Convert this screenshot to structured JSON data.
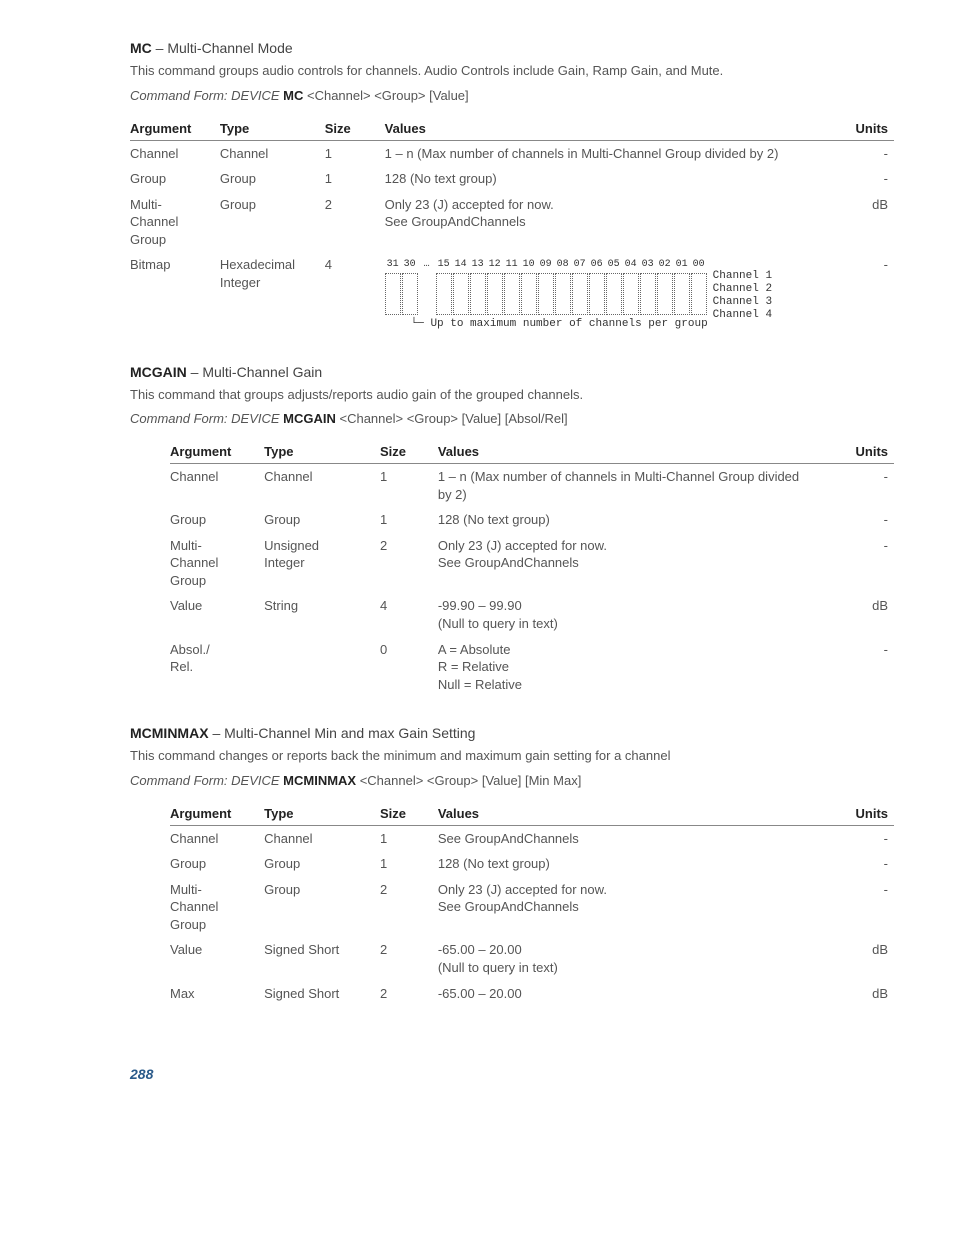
{
  "page_number": "288",
  "sections": [
    {
      "id": "mc",
      "code": "MC",
      "title": "Multi-Channel Mode",
      "desc": "This command groups audio controls for channels.  Audio Controls include Gain, Ramp Gain, and Mute.",
      "cmd_prefix": "Command Form:  DEVICE ",
      "cmd_code": "MC",
      "cmd_suffix": " <Channel> <Group> [Value]",
      "indent": false,
      "cols": {
        "arg": "Argument",
        "type": "Type",
        "size": "Size",
        "values": "Values",
        "units": "Units"
      },
      "rows": [
        {
          "arg": "Channel",
          "type": "Channel",
          "size": "1",
          "values": "1 – n (Max number of channels in Multi-Channel Group divided by 2)",
          "units": "-"
        },
        {
          "arg": "Group",
          "type": "Group",
          "size": "1",
          "values": "128 (No text group)",
          "units": "-"
        },
        {
          "arg": "Multi-\nChannel\nGroup",
          "type": "Group",
          "size": "2",
          "values": "Only 23 (J) accepted for now.\nSee GroupAndChannels",
          "units": "dB"
        },
        {
          "arg": "Bitmap",
          "type": "Hexadecimal\nInteger",
          "size": "4",
          "values_is_bitmap": true,
          "units": "-"
        }
      ],
      "bitmap": {
        "bits_left": [
          "31",
          "30"
        ],
        "bits_ellipsis": "…",
        "bits_right": [
          "15",
          "14",
          "13",
          "12",
          "11",
          "10",
          "09",
          "08",
          "07",
          "06",
          "05",
          "04",
          "03",
          "02",
          "01",
          "00"
        ],
        "labels": [
          "Channel 1",
          "Channel 2",
          "Channel 3",
          "Channel 4"
        ],
        "caption": "Up to maximum number of channels per group"
      }
    },
    {
      "id": "mcgain",
      "code": "MCGAIN",
      "title": "Multi-Channel Gain",
      "desc": "This command that groups adjusts/reports audio gain of the grouped channels.",
      "cmd_prefix": "Command Form:  DEVICE ",
      "cmd_code": "MCGAIN",
      "cmd_suffix": " <Channel> <Group> [Value] [Absol/Rel]",
      "indent": true,
      "cols": {
        "arg": "Argument",
        "type": "Type",
        "size": "Size",
        "values": "Values",
        "units": "Units"
      },
      "rows": [
        {
          "arg": "Channel",
          "type": "Channel",
          "size": "1",
          "values": "1 – n (Max number of channels in Multi-Channel Group divided by 2)",
          "units": "-"
        },
        {
          "arg": "Group",
          "type": "Group",
          "size": "1",
          "values": "128 (No text group)",
          "units": "-"
        },
        {
          "arg": "Multi-\nChannel\nGroup",
          "type": "Unsigned\nInteger",
          "size": "2",
          "values": "Only 23 (J) accepted for now.\nSee GroupAndChannels",
          "units": "-"
        },
        {
          "arg": "Value",
          "type": "String",
          "size": "4",
          "values": "-99.90 – 99.90\n(Null to query in text)",
          "units": "dB"
        },
        {
          "arg": "Absol./\nRel.",
          "type": "",
          "size": "0",
          "values": "A = Absolute\nR = Relative\nNull = Relative",
          "units": "-"
        }
      ]
    },
    {
      "id": "mcminmax",
      "code": "MCMINMAX",
      "title": "Multi-Channel Min and max Gain Setting",
      "desc": "This command changes or reports back the minimum and maximum gain setting for a channel",
      "cmd_prefix": "Command Form:  DEVICE ",
      "cmd_code": "MCMINMAX",
      "cmd_suffix": " <Channel> <Group> [Value] [Min Max]",
      "indent": true,
      "cols": {
        "arg": "Argument",
        "type": "Type",
        "size": "Size",
        "values": "Values",
        "units": "Units"
      },
      "rows": [
        {
          "arg": "Channel",
          "type": "Channel",
          "size": "1",
          "values": "See GroupAndChannels",
          "units": "-"
        },
        {
          "arg": "Group",
          "type": "Group",
          "size": "1",
          "values": "128 (No text group)",
          "units": "-"
        },
        {
          "arg": "Multi-\nChannel\nGroup",
          "type": "Group",
          "size": "2",
          "values": "Only 23 (J) accepted for now.\nSee GroupAndChannels",
          "units": "-"
        },
        {
          "arg": "Value",
          "type": "Signed Short",
          "size": "2",
          "values": "-65.00 – 20.00\n(Null to query in text)",
          "units": "dB"
        },
        {
          "arg": "Max",
          "type": "Signed Short",
          "size": "2",
          "values": "-65.00 – 20.00",
          "units": "dB"
        }
      ]
    }
  ]
}
